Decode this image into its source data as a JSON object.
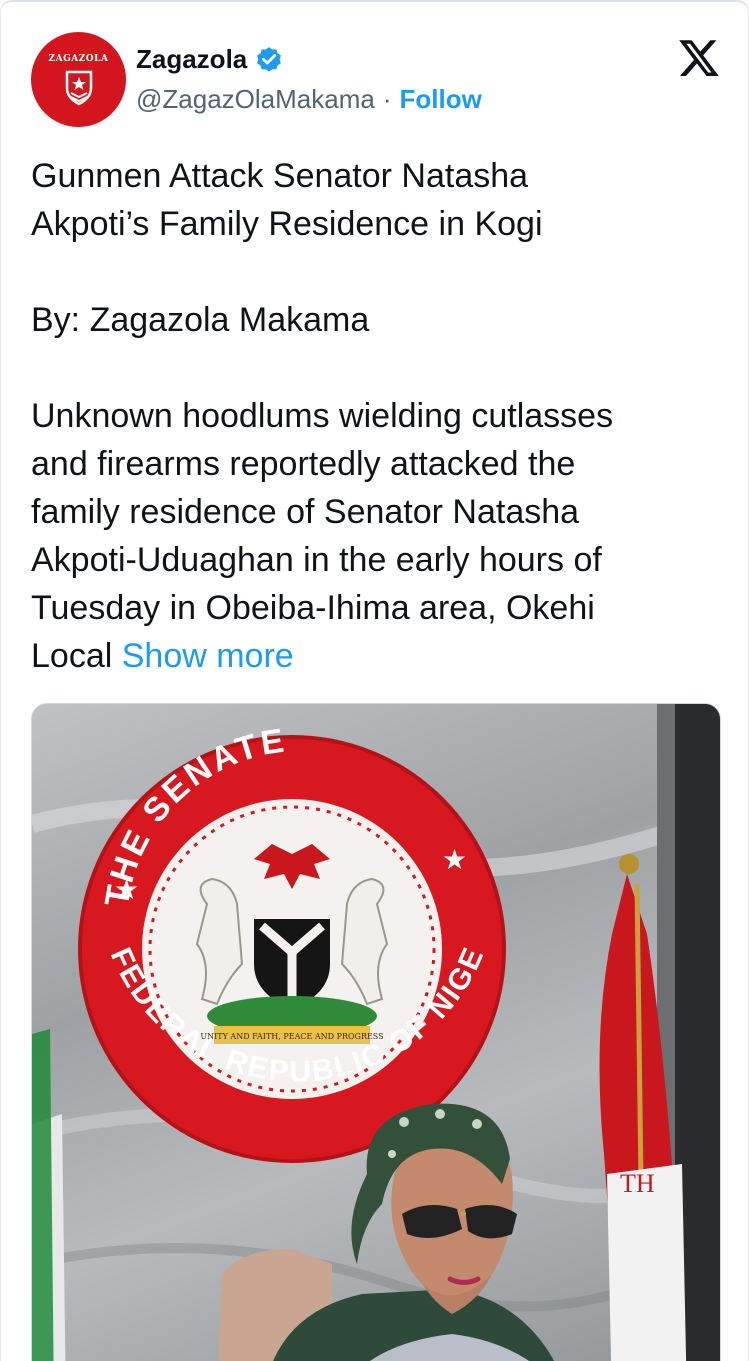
{
  "author": {
    "avatar_text": "ZAGAZOLA",
    "name": "Zagazola",
    "handle": "@ZagazOlaMakama",
    "separator": "·",
    "follow_label": "Follow"
  },
  "tweet": {
    "headline_lines": [
      "Gunmen Attack Senator Natasha",
      "Akpoti’s Family Residence in Kogi"
    ],
    "byline": "By: Zagazola Makama",
    "body_lines": [
      "Unknown hoodlums wielding cutlasses",
      "and firearms reportedly attacked the",
      "family residence of Senator Natasha",
      "Akpoti-Uduaghan in the early hours of",
      "Tuesday in Obeiba-Ihima area, Okehi",
      "Local"
    ],
    "show_more": "Show more"
  },
  "media": {
    "seal_top": "THE SENATE",
    "seal_bottom": "FEDERAL REPUBLIC OF NIGERIA",
    "motto": "UNITY AND FAITH, PEACE AND PROGRESS",
    "flag_text": "TH"
  },
  "colors": {
    "accent": "#1d9bf0",
    "avatar_red": "#d3161d",
    "seal_red": "#d7191f",
    "text": "#0f1419",
    "muted": "#536471"
  },
  "icons": {
    "verified": "verified-badge-icon",
    "platform": "x-logo-icon"
  }
}
